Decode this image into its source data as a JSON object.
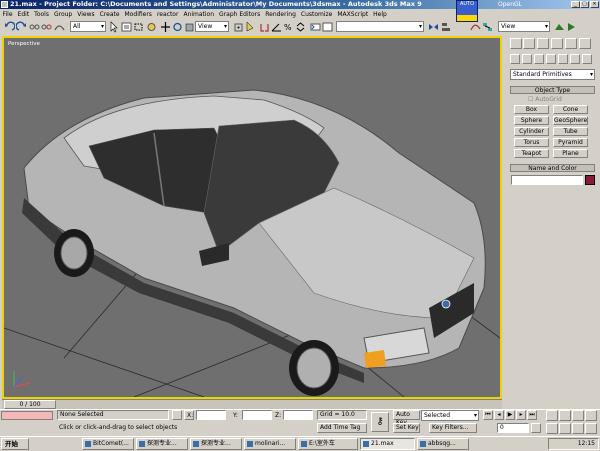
{
  "window": {
    "title": "21.max   - Project Folder: C:\\Documents and Settings\\Administrator\\My Documents\\3dsmax    - Autodesk 3ds Max 9",
    "renderer_label": "OpenGL",
    "badge_text": "AUTO"
  },
  "menu": [
    "File",
    "Edit",
    "Tools",
    "Group",
    "Views",
    "Create",
    "Modifiers",
    "reactor",
    "Animation",
    "Graph Editors",
    "Rendering",
    "Customize",
    "MAXScript",
    "Help"
  ],
  "toolbar": {
    "selection_filter": "All",
    "ref_coord": "View",
    "named_selection": "",
    "right_view": "View"
  },
  "viewport": {
    "label": "Perspective",
    "active_border_color": "#f0d400",
    "background_color": "#6f6f6f"
  },
  "command_panel": {
    "category": "Standard Primitives",
    "object_type_title": "Object Type",
    "autogrid_label": "AutoGrid",
    "buttons": [
      "Box",
      "Cone",
      "Sphere",
      "GeoSphere",
      "Cylinder",
      "Tube",
      "Torus",
      "Pyramid",
      "Teapot",
      "Plane"
    ],
    "name_color_title": "Name and Color",
    "name_value": "",
    "object_color": "#8b1a3a"
  },
  "timeline": {
    "slider_text": "0 / 100",
    "slider_position": 0.0
  },
  "status": {
    "selection_status": "None Selected",
    "prompt": "Click or click-and-drag to select objects",
    "x_label": "X:",
    "y_label": "Y:",
    "z_label": "Z:",
    "x_value": "",
    "y_value": "",
    "z_value": "",
    "grid": "Grid = 10.0",
    "add_time_tag": "Add Time Tag",
    "auto_key": "Auto Key",
    "set_key": "Set Key",
    "key_mode": "Selected",
    "key_filters": "Key Filters...",
    "frame": "0"
  },
  "taskbar": {
    "start": "开始",
    "tasks": [
      "BitComet(...",
      "探测专业...",
      "探测专业...",
      "molinari...",
      "E:\\室外车",
      "21.max",
      "abbsqg..."
    ],
    "active_task_index": 5,
    "clock": "12:15"
  }
}
